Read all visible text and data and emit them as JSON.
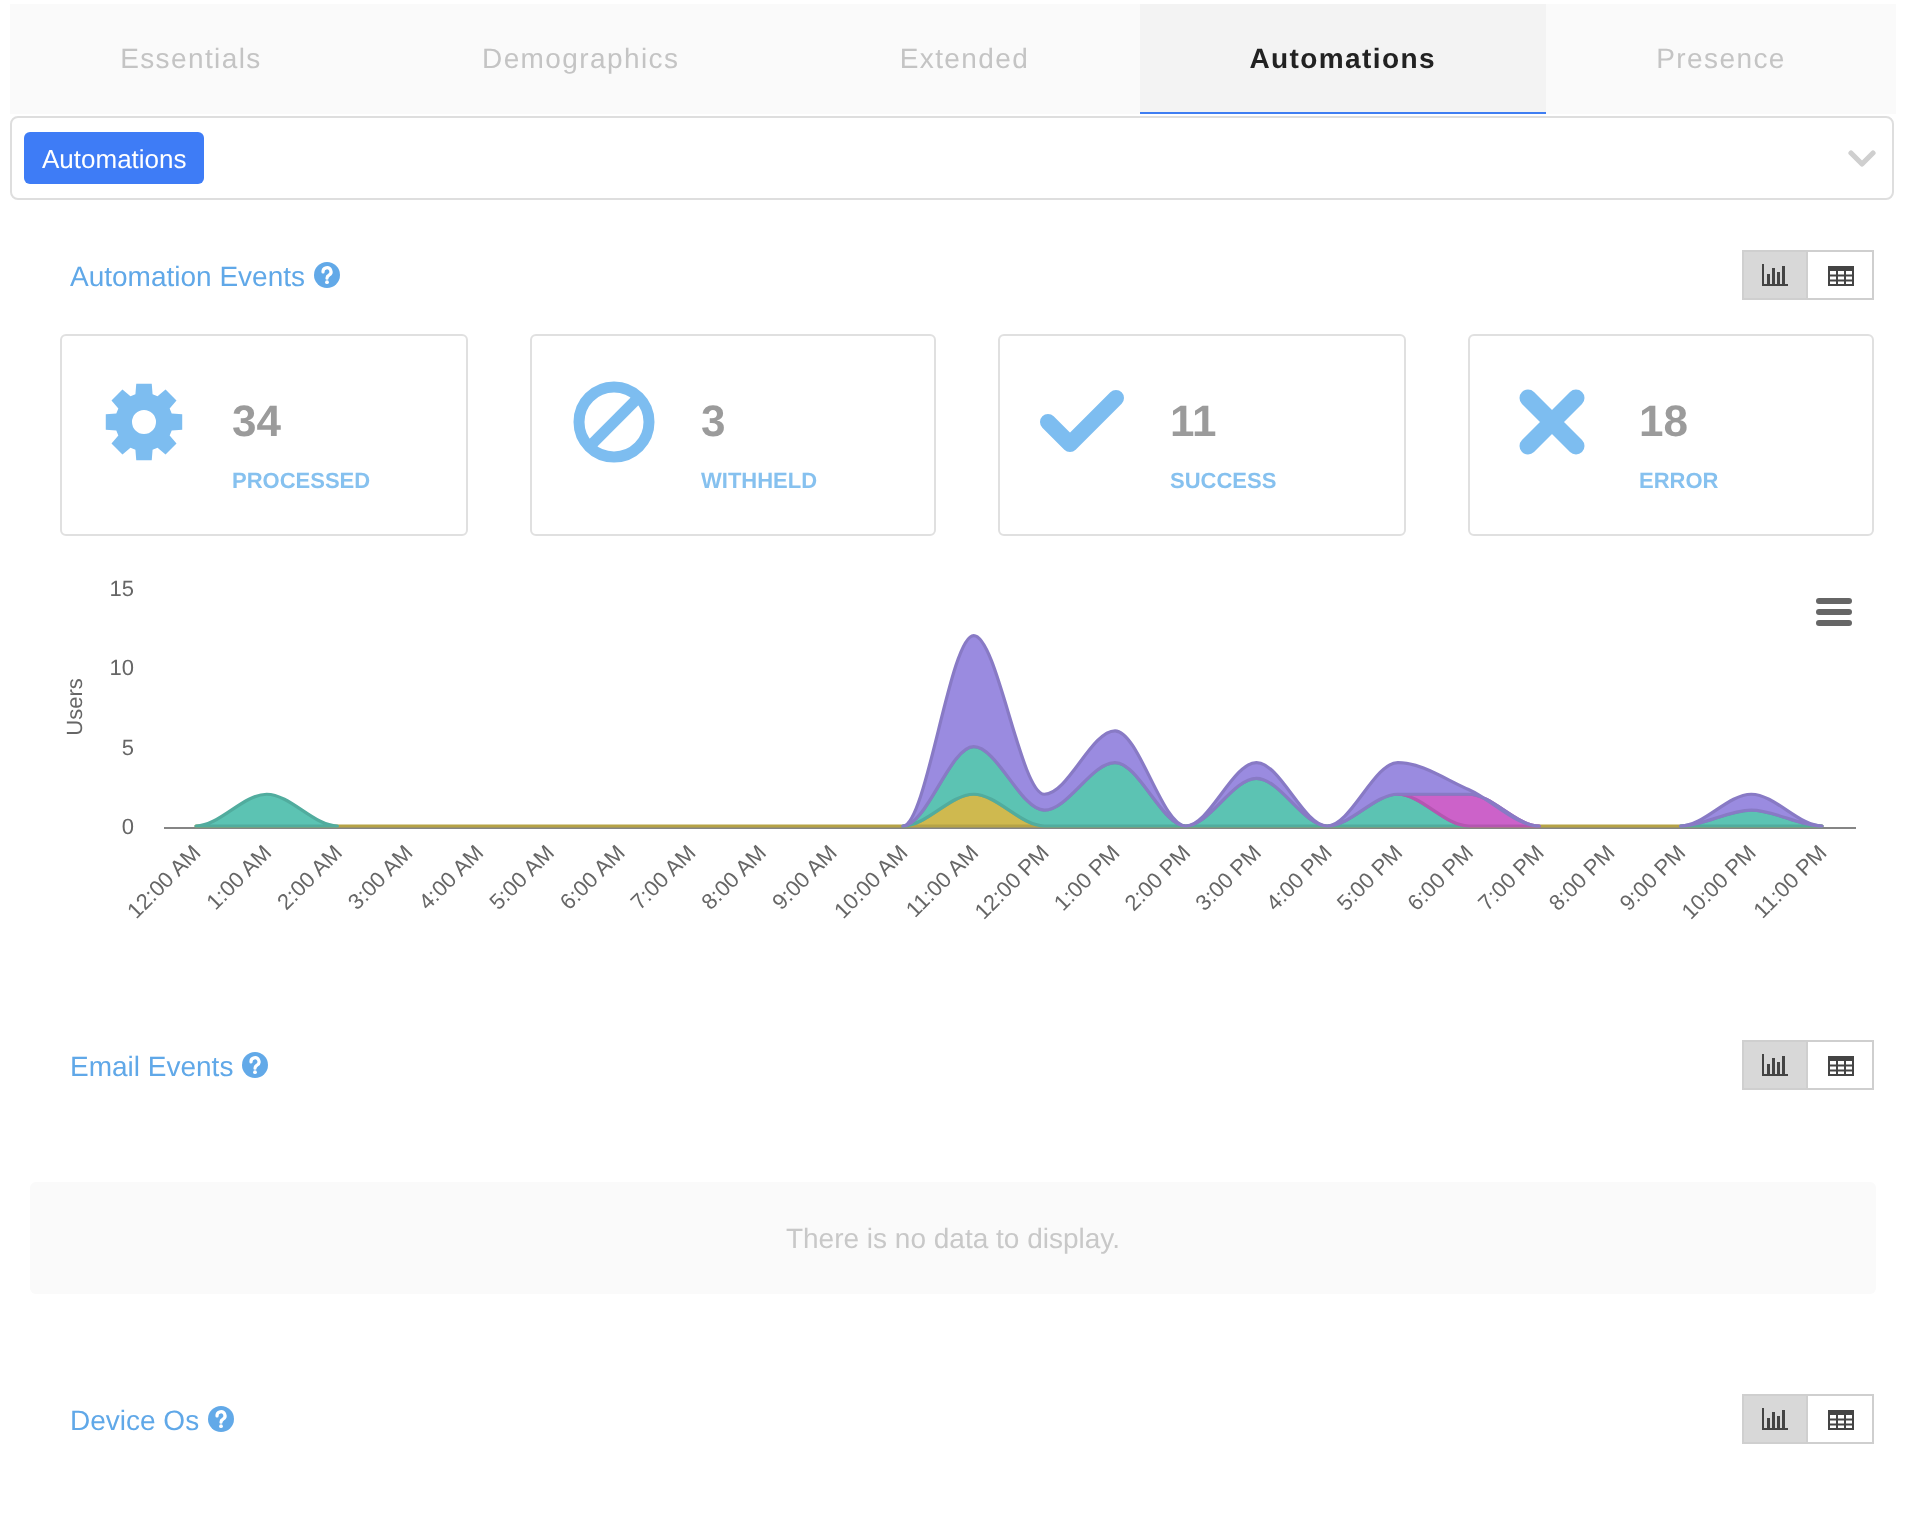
{
  "tabs": [
    {
      "label": "Essentials",
      "selected": false
    },
    {
      "label": "Demographics",
      "selected": false
    },
    {
      "label": "Extended",
      "selected": false
    },
    {
      "label": "Automations",
      "selected": true
    },
    {
      "label": "Presence",
      "selected": false
    }
  ],
  "filter": {
    "chips": [
      "Automations"
    ]
  },
  "sections": [
    {
      "title": "Automation Events",
      "view_toggle": [
        {
          "kind": "chart",
          "selected": true
        },
        {
          "kind": "table",
          "selected": false
        }
      ],
      "stats": [
        {
          "kind": "processed",
          "value": "34",
          "label": "PROCESSED"
        },
        {
          "kind": "withheld",
          "value": "3",
          "label": "WITHHELD"
        },
        {
          "kind": "success",
          "value": "11",
          "label": "SUCCESS"
        },
        {
          "kind": "error",
          "value": "18",
          "label": "ERROR"
        }
      ],
      "chart_data": {
        "type": "area",
        "ylabel": "Users",
        "categories": [
          "12:00 AM",
          "1:00 AM",
          "2:00 AM",
          "3:00 AM",
          "4:00 AM",
          "5:00 AM",
          "6:00 AM",
          "7:00 AM",
          "8:00 AM",
          "9:00 AM",
          "10:00 AM",
          "11:00 AM",
          "12:00 PM",
          "1:00 PM",
          "2:00 PM",
          "3:00 PM",
          "4:00 PM",
          "5:00 PM",
          "6:00 PM",
          "7:00 PM",
          "8:00 PM",
          "9:00 PM",
          "10:00 PM",
          "11:00 PM"
        ],
        "series": [
          {
            "color": "#cfb94f",
            "values": [
              0,
              0,
              0,
              0,
              0,
              0,
              0,
              0,
              0,
              0,
              0,
              2,
              0,
              0,
              0,
              0,
              0,
              0,
              0,
              0,
              0,
              0,
              0,
              0
            ]
          },
          {
            "color": "#5cc3b3",
            "values": [
              0,
              2,
              0,
              null,
              null,
              null,
              null,
              null,
              null,
              null,
              0,
              3,
              1,
              4,
              0,
              3,
              0,
              2,
              0,
              null,
              null,
              0,
              1,
              0
            ]
          },
          {
            "color": "#cc62c9",
            "values": [
              null,
              null,
              null,
              null,
              null,
              null,
              null,
              null,
              null,
              null,
              null,
              null,
              null,
              null,
              null,
              null,
              null,
              0,
              2,
              0,
              null,
              null,
              null,
              null
            ]
          },
          {
            "color": "#9a8be0",
            "values": [
              null,
              null,
              null,
              null,
              null,
              null,
              null,
              null,
              null,
              null,
              0,
              7,
              1,
              2,
              0,
              1,
              0,
              2,
              0.3,
              0,
              null,
              0,
              1,
              0
            ]
          }
        ],
        "ylim": [
          0,
          15
        ],
        "yticks": [
          0,
          5,
          10,
          15
        ],
        "stacked": true
      }
    },
    {
      "title": "Email Events",
      "view_toggle": [
        {
          "kind": "chart",
          "selected": true
        },
        {
          "kind": "table",
          "selected": false
        }
      ],
      "empty_message": "There is no data to display."
    },
    {
      "title": "Device Os",
      "view_toggle": [
        {
          "kind": "chart",
          "selected": true
        },
        {
          "kind": "table",
          "selected": false
        }
      ]
    }
  ]
}
